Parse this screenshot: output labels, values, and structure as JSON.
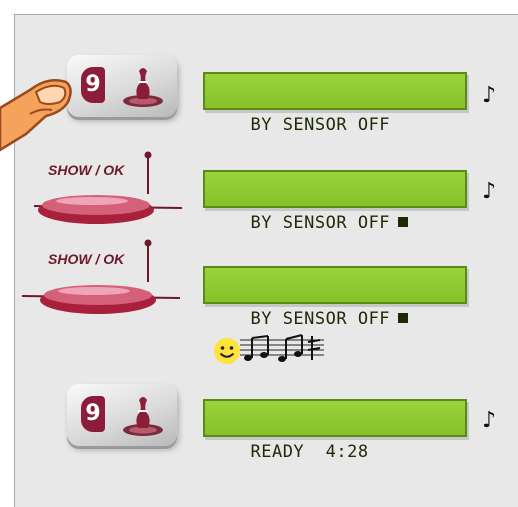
{
  "steps": [
    {
      "kind": "key",
      "key_number": "9",
      "display": "BY SENSOR OFF",
      "cursor": false,
      "note": "♪"
    },
    {
      "kind": "show",
      "label": "SHOW / OK",
      "display": "BY SENSOR OFF",
      "cursor": true,
      "note": "♪"
    },
    {
      "kind": "show",
      "label": "SHOW / OK",
      "display": "BY SENSOR OFF",
      "cursor": true,
      "note": ""
    },
    {
      "kind": "key",
      "key_number": "9",
      "display": "READY  4:28",
      "cursor": false,
      "note": "♪"
    }
  ],
  "icons": {
    "hand": "pointing-hand-icon",
    "key_symbol": "bowling-pin-icon",
    "smiley": "smiley-icon",
    "melody": "music-notes-icon"
  },
  "colors": {
    "lcd": "#92cc34",
    "lcd_border": "#5c8a16",
    "button": "#c53b57",
    "label": "#6b1a2c",
    "key_badge": "#8c1d3a"
  }
}
